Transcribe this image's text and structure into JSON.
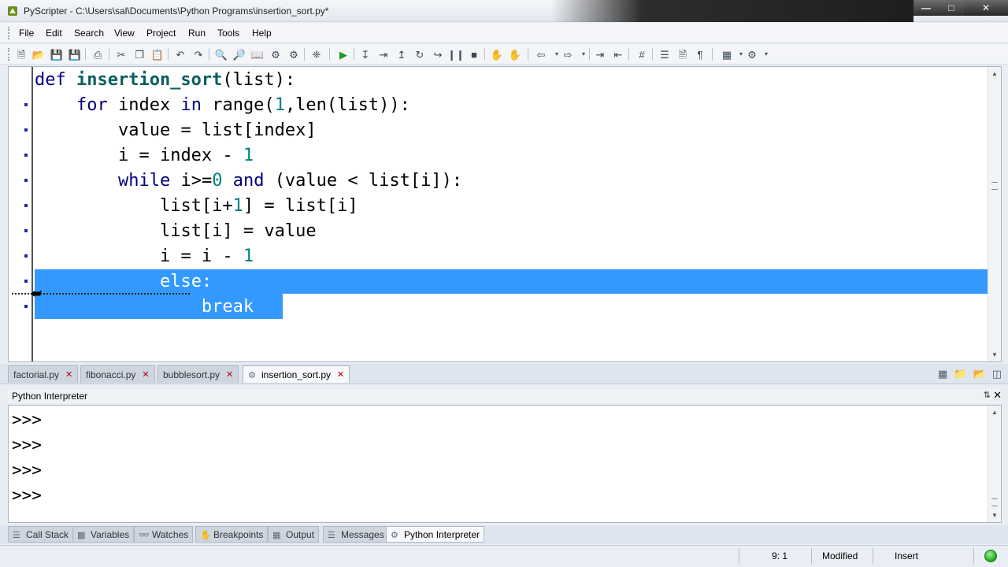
{
  "window": {
    "title": "PyScripter - C:\\Users\\sal\\Documents\\Python Programs\\insertion_sort.py*"
  },
  "menu": [
    "File",
    "Edit",
    "Search",
    "View",
    "Project",
    "Run",
    "Tools",
    "Help"
  ],
  "toolbar_icons": [
    "new-file-icon",
    "open-folder-icon",
    "save-icon",
    "save-all-icon",
    "print-icon",
    "cut-icon",
    "copy-icon",
    "paste-icon",
    "back-icon",
    "forward-icon",
    "find-icon",
    "find-replace-icon",
    "find-in-files-icon",
    "syntax-check-icon",
    "debug-icon",
    "run-icon",
    "step-into-icon",
    "step-over-icon",
    "step-out-icon",
    "run-to-cursor-icon",
    "pause-icon",
    "stop-icon",
    "toggle-breakpoint-icon",
    "clear-breakpoints-icon",
    "nav-back-icon",
    "nav-forward-icon",
    "indent-icon",
    "unindent-icon",
    "comment-icon",
    "numbered-list-icon",
    "toggle-view-icon",
    "pilcrow-icon",
    "layout-icon",
    "options-icon"
  ],
  "editor": {
    "lines": [
      {
        "indent": "",
        "parts": [
          [
            "kw",
            "def "
          ],
          [
            "fn",
            "insertion_sort"
          ],
          [
            "",
            "(list):"
          ]
        ]
      },
      {
        "indent": "    ",
        "parts": [
          [
            "kw",
            "for "
          ],
          [
            "",
            "index "
          ],
          [
            "kw",
            "in "
          ],
          [
            "",
            "range("
          ],
          [
            "num",
            "1"
          ],
          [
            "",
            ",len(list)):"
          ]
        ]
      },
      {
        "indent": "        ",
        "parts": [
          [
            "",
            "value = list[index]"
          ]
        ]
      },
      {
        "indent": "        ",
        "parts": [
          [
            "",
            "i = index - "
          ],
          [
            "num",
            "1"
          ]
        ]
      },
      {
        "indent": "        ",
        "parts": [
          [
            "kw",
            "while "
          ],
          [
            "",
            "i>="
          ],
          [
            "num",
            "0"
          ],
          [
            "kw",
            " and "
          ],
          [
            "",
            "(value < list[i]):"
          ]
        ]
      },
      {
        "indent": "            ",
        "parts": [
          [
            "",
            "list[i+"
          ],
          [
            "num",
            "1"
          ],
          [
            "",
            "] = list[i]"
          ]
        ]
      },
      {
        "indent": "            ",
        "parts": [
          [
            "",
            "list[i] = value"
          ]
        ]
      },
      {
        "indent": "            ",
        "parts": [
          [
            "",
            "i = i - "
          ],
          [
            "num",
            "1"
          ]
        ]
      },
      {
        "indent": "            ",
        "parts": [
          [
            "sel",
            "else:"
          ]
        ]
      },
      {
        "indent": "                ",
        "parts": [
          [
            "sel",
            "break"
          ]
        ]
      }
    ]
  },
  "doc_tabs": [
    {
      "label": "factorial.py",
      "active": false
    },
    {
      "label": "fibonacci.py",
      "active": false
    },
    {
      "label": "bubblesort.py",
      "active": false
    },
    {
      "label": "insertion_sort.py",
      "active": true
    }
  ],
  "interpreter": {
    "title": "Python Interpreter",
    "prompts": [
      ">>>",
      ">>>",
      ">>>",
      ">>>"
    ]
  },
  "bottom_tabs": [
    {
      "label": "Call Stack",
      "icon": "call-stack-icon",
      "active": false
    },
    {
      "label": "Variables",
      "icon": "variables-icon",
      "active": false
    },
    {
      "label": "Watches",
      "icon": "watches-icon",
      "active": false
    },
    {
      "label": "Breakpoints",
      "icon": "breakpoints-icon",
      "active": false
    },
    {
      "label": "Output",
      "icon": "output-icon",
      "active": false
    },
    {
      "label": "Messages",
      "icon": "messages-icon",
      "active": false
    },
    {
      "label": "Python Interpreter",
      "icon": "python-icon",
      "active": true
    }
  ],
  "status": {
    "position": "9: 1",
    "modified": "Modified",
    "mode": "Insert"
  },
  "colors": {
    "selection": "#3399ff",
    "keyword": "#000080",
    "number": "#008080",
    "function": "#0b5f5f"
  }
}
